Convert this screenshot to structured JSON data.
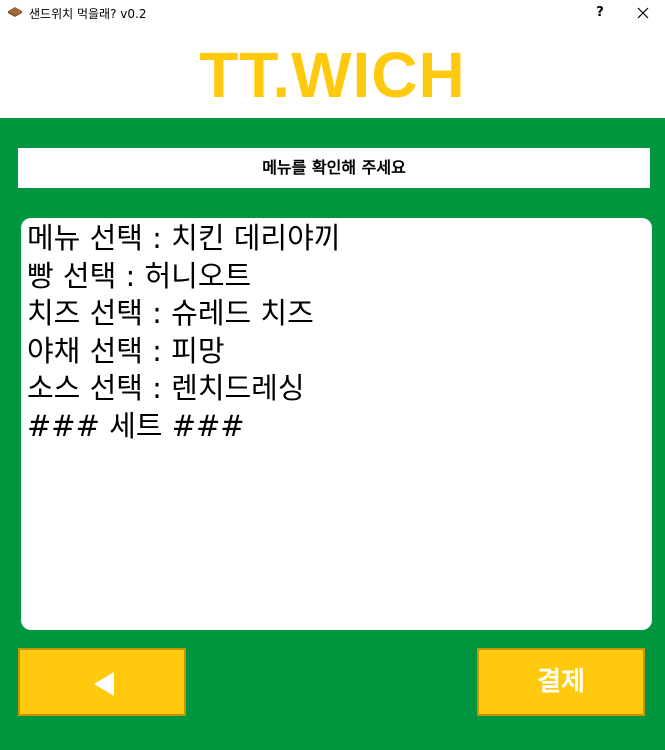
{
  "window": {
    "title": "샌드위치 먹을래? v0.2",
    "help_label": "?",
    "icon": "sandwich-icon"
  },
  "logo": {
    "text": "TT.WICH"
  },
  "banner": {
    "text": "메뉴를 확인해 주세요"
  },
  "summary": {
    "lines": [
      "메뉴 선택 : 치킨 데리야끼",
      "빵 선택 : 허니오트",
      "치즈 선택 : 슈레드 치즈",
      "야채 선택 : 피망",
      "소스 선택 : 렌치드레싱",
      "### 세트 ###"
    ]
  },
  "buttons": {
    "back_icon": "left-triangle-icon",
    "pay_label": "결제"
  },
  "colors": {
    "brand_green": "#00963f",
    "accent_yellow": "#ffc90e",
    "text": "#000000",
    "panel_white": "#ffffff"
  }
}
